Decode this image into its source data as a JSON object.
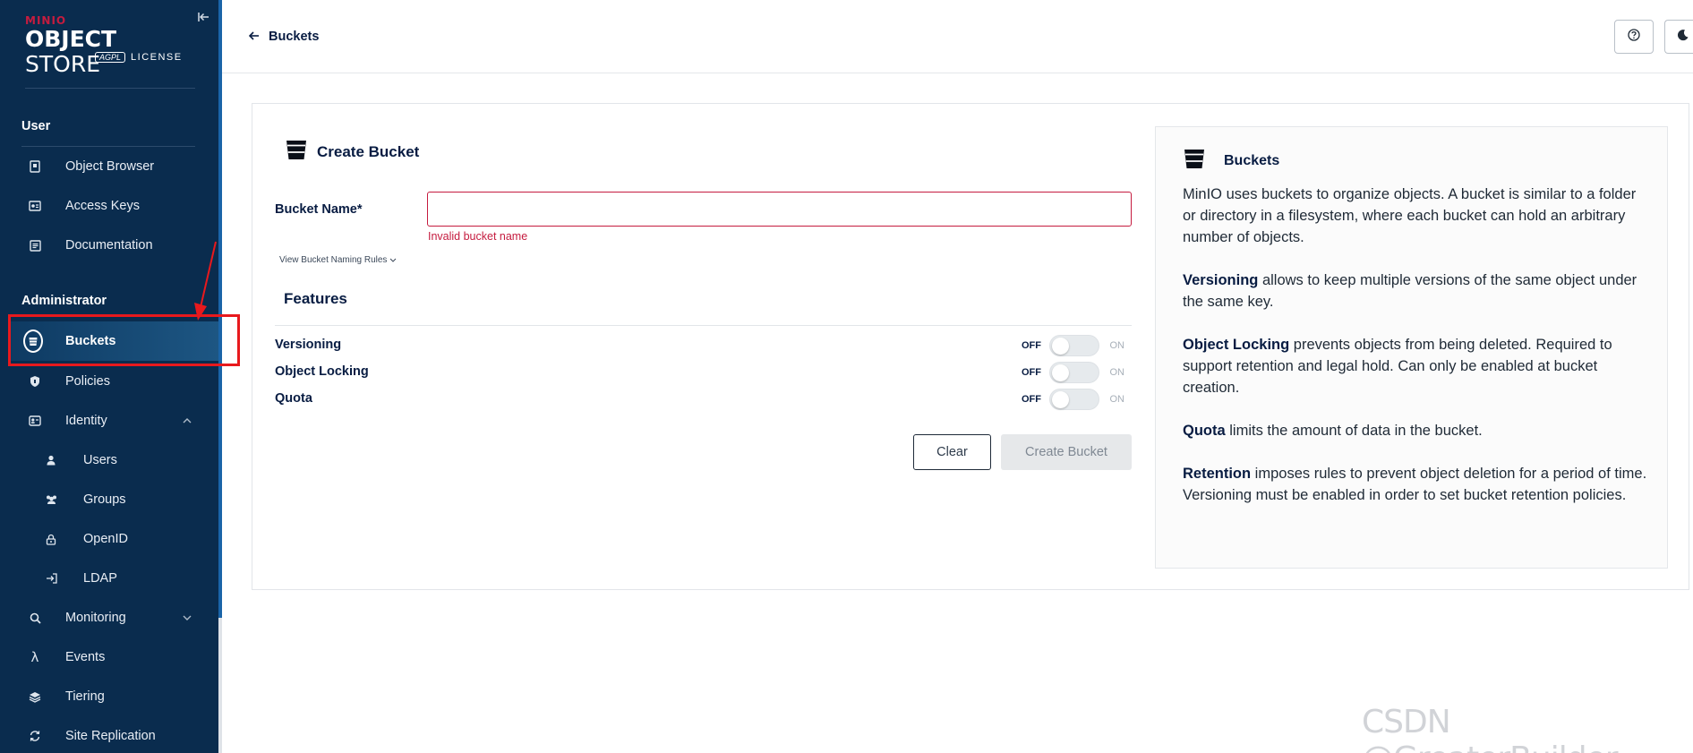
{
  "brand": {
    "minio": "MINIO",
    "title_bold": "OBJECT",
    "title_thin": "STORE",
    "agpl": "AGPL",
    "license": "LICENSE"
  },
  "sidebar": {
    "user_section": "User",
    "user_items": [
      {
        "label": "Object Browser",
        "icon": "object-browser-icon"
      },
      {
        "label": "Access Keys",
        "icon": "access-keys-icon"
      },
      {
        "label": "Documentation",
        "icon": "documentation-icon"
      }
    ],
    "admin_section": "Administrator",
    "admin_items": [
      {
        "label": "Buckets",
        "icon": "bucket-icon",
        "active": true
      },
      {
        "label": "Policies",
        "icon": "shield-icon"
      },
      {
        "label": "Identity",
        "icon": "id-card-icon",
        "expanded": true
      },
      {
        "label": "Users",
        "icon": "user-icon",
        "sub": true
      },
      {
        "label": "Groups",
        "icon": "group-icon",
        "sub": true
      },
      {
        "label": "OpenID",
        "icon": "lock-icon",
        "sub": true
      },
      {
        "label": "LDAP",
        "icon": "login-icon",
        "sub": true
      },
      {
        "label": "Monitoring",
        "icon": "search-icon",
        "expanded": false
      },
      {
        "label": "Events",
        "icon": "lambda-icon"
      },
      {
        "label": "Tiering",
        "icon": "layers-icon"
      },
      {
        "label": "Site Replication",
        "icon": "sync-icon"
      }
    ]
  },
  "topbar": {
    "back_label": "Buckets"
  },
  "form": {
    "title": "Create Bucket",
    "bucket_name_label": "Bucket Name*",
    "bucket_name_value": "",
    "error": "Invalid bucket name",
    "naming_rules": "View Bucket Naming Rules",
    "features_title": "Features",
    "features": [
      {
        "label": "Versioning",
        "off": "OFF",
        "on": "ON",
        "enabled": false
      },
      {
        "label": "Object Locking",
        "off": "OFF",
        "on": "ON",
        "enabled": false
      },
      {
        "label": "Quota",
        "off": "OFF",
        "on": "ON",
        "enabled": false
      }
    ],
    "clear_label": "Clear",
    "create_label": "Create Bucket"
  },
  "help": {
    "title": "Buckets",
    "intro": "MinIO uses buckets to organize objects. A bucket is similar to a folder or directory in a filesystem, where each bucket can hold an arbitrary number of objects.",
    "versioning_term": "Versioning",
    "versioning_text": " allows to keep multiple versions of the same object under the same key.",
    "locking_term": "Object Locking",
    "locking_text": " prevents objects from being deleted. Required to support retention and legal hold. Can only be enabled at bucket creation.",
    "quota_term": "Quota",
    "quota_text": " limits the amount of data in the bucket.",
    "retention_term": "Retention",
    "retention_text": " imposes rules to prevent object deletion for a period of time. Versioning must be enabled in order to set bucket retention policies."
  },
  "watermark": "CSDN @GreaterBuilder",
  "colors": {
    "sidebar_bg": "#0a2c4e",
    "error": "#c51b3f",
    "text": "#081c42",
    "highlight": "#e8191d"
  }
}
